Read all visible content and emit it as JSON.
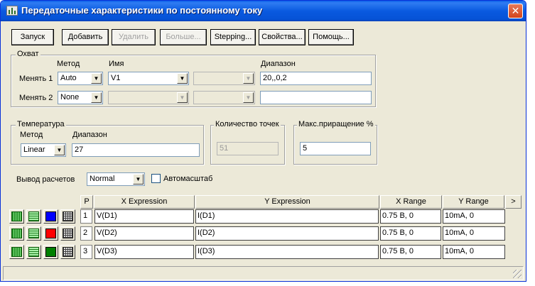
{
  "window": {
    "title": "Передаточные характеристики по постоянному току",
    "close_glyph": "✕"
  },
  "toolbar": {
    "run": "Запуск",
    "add": "Добавить",
    "delete": "Удалить",
    "more": "Больше...",
    "stepping": "Stepping...",
    "properties": "Свойства...",
    "help": "Помощь..."
  },
  "sweep": {
    "title": "Охват",
    "method_header": "Метод",
    "name_header": "Имя",
    "range_header": "Диапазон",
    "rows": [
      {
        "label": "Менять 1",
        "method": "Auto",
        "name": "V1",
        "range": "20,,0,2"
      },
      {
        "label": "Менять 2",
        "method": "None",
        "name": "",
        "range": ""
      }
    ]
  },
  "temperature": {
    "title": "Температура",
    "method_label": "Метод",
    "range_label": "Диапазон",
    "method": "Linear",
    "range": "27"
  },
  "points": {
    "title": "Количество точек",
    "value": "51"
  },
  "max_step": {
    "title": "Макс.приращение %",
    "value": "5"
  },
  "output": {
    "label": "Вывод  расчетов",
    "mode": "Normal",
    "autoscale_label": "Автомасштаб",
    "autoscale_checked": false
  },
  "table": {
    "headers": {
      "p": "P",
      "x_expr": "X Expression",
      "y_expr": "Y Expression",
      "x_range": "X Range",
      "y_range": "Y Range",
      "more": ">"
    },
    "rows": [
      {
        "p": "1",
        "x_expr": "V(D1)",
        "y_expr": "I(D1)",
        "x_range": "0.75 B, 0",
        "y_range": "10mA, 0",
        "color": "#0000ff"
      },
      {
        "p": "2",
        "x_expr": "V(D2)",
        "y_expr": "I(D2)",
        "x_range": "0.75 B, 0",
        "y_range": "10mA, 0",
        "color": "#ff0000"
      },
      {
        "p": "3",
        "x_expr": "V(D3)",
        "y_expr": "I(D3)",
        "x_range": "0.75 B, 0",
        "y_range": "10mA, 0",
        "color": "#008000"
      }
    ]
  },
  "icons": {
    "bars": "vertical-bars-icon",
    "lines": "horizontal-lines-icon",
    "grid": "grid-icon"
  }
}
